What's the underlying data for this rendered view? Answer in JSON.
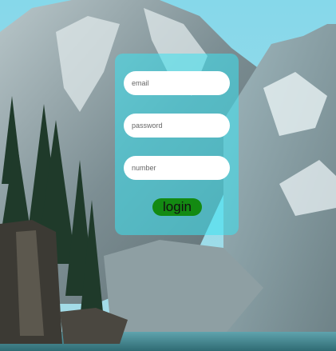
{
  "form": {
    "email_placeholder": "email",
    "password_placeholder": "password",
    "number_placeholder": "number",
    "login_label": "login"
  },
  "colors": {
    "card": "#3ce1f0",
    "button": "#138a12",
    "field": "#ffffff"
  }
}
